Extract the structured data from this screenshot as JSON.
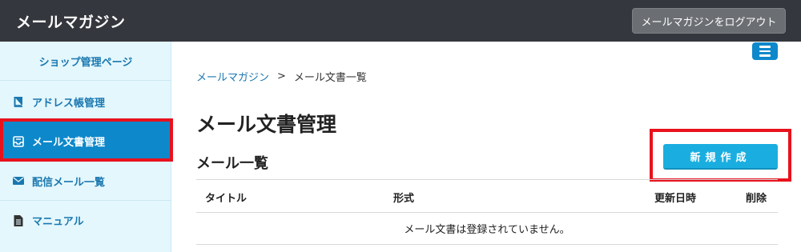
{
  "header": {
    "app_title": "メールマガジン",
    "logout_label": "メールマガジンをログアウト"
  },
  "sidebar": {
    "items": [
      {
        "label": "ショップ管理ページ",
        "icon": ""
      },
      {
        "label": "アドレス帳管理",
        "icon": "address-book-icon"
      },
      {
        "label": "メール文書管理",
        "icon": "inbox-icon",
        "active": true
      },
      {
        "label": "配信メール一覧",
        "icon": "envelope-icon"
      },
      {
        "label": "マニュアル",
        "icon": "document-icon"
      }
    ]
  },
  "breadcrumb": {
    "link": "メールマガジン",
    "separator": ">",
    "current": "メール文書一覧"
  },
  "main": {
    "page_title": "メール文書管理",
    "section_title": "メール一覧",
    "new_button_label": "新規作成",
    "table": {
      "columns": [
        "タイトル",
        "形式",
        "更新日時",
        "削除"
      ],
      "empty_message": "メール文書は登録されていません。"
    }
  },
  "colors": {
    "topbar": "#34373d",
    "accent": "#0d88cb",
    "button": "#1aaee0",
    "highlight": "#e8121d",
    "sidebar_bg": "#e4f7fd"
  }
}
